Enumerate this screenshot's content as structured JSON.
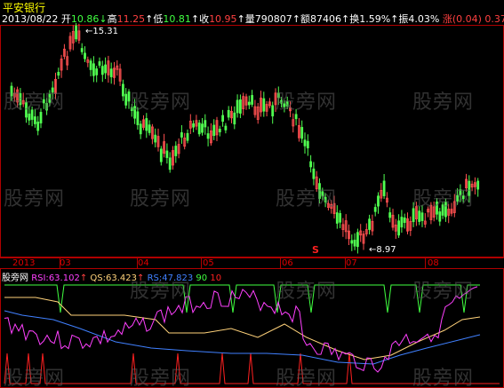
{
  "title": "平安银行",
  "header": {
    "date": "2013/08/22",
    "open_label": "开",
    "open": "10.86",
    "high_label": "高",
    "high": "11.25",
    "low_label": "低",
    "low": "10.81",
    "close_label": "收",
    "close": "10.95",
    "vol_label": "量",
    "vol": "790807",
    "amt_label": "额",
    "amt": "87406",
    "turn_label": "换",
    "turn": "1.59%",
    "amp_label": "振",
    "amp": "4.03%",
    "chg_label": "涨",
    "chg": "(0.04)",
    "chg2": "0.37"
  },
  "annotations": {
    "high_marker": "15.31",
    "low_marker": "8.97",
    "signal": "S"
  },
  "x_labels": [
    "2013",
    "03",
    "04",
    "05",
    "06",
    "07",
    "08"
  ],
  "watermark": "股旁网",
  "indicator": {
    "name": "股旁网",
    "rsi_label": "RSI:",
    "rsi": "63.102",
    "qs_label": "QS:",
    "qs": "63.423",
    "rs_label": "RS:",
    "rs": "47.823",
    "level1": "90",
    "level2": "10"
  },
  "colors": {
    "up": "#ff5050",
    "down": "#50ff50",
    "frame": "#b00000",
    "rsi": "#ff40ff",
    "qs": "#ffd27a",
    "rs": "#4080ff",
    "lvl90": "#40ff40",
    "lvl10": "#ff2020"
  }
}
